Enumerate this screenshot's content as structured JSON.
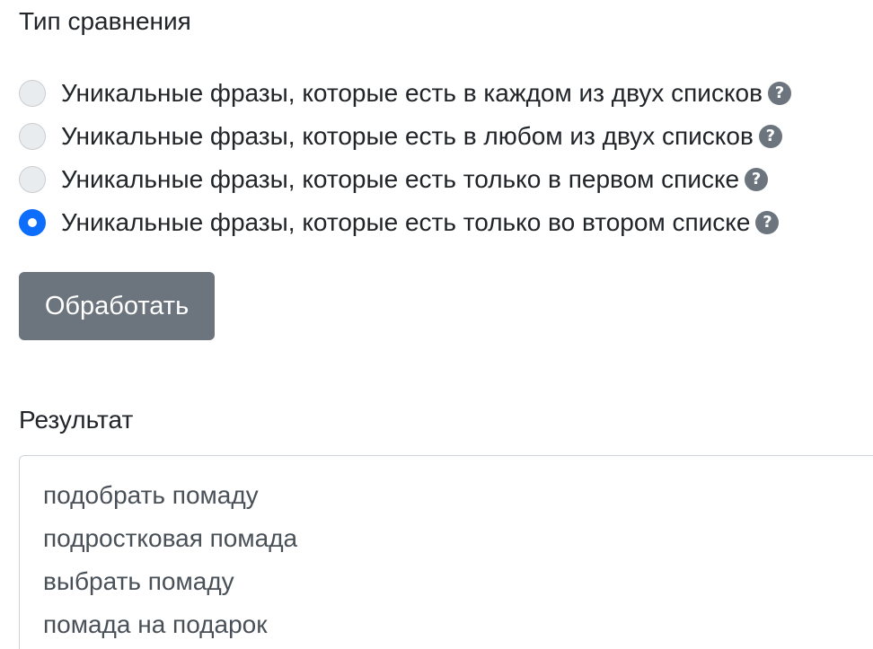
{
  "comparison": {
    "title": "Тип сравнения",
    "options": [
      {
        "label": "Уникальные фразы, которые есть в каждом из двух списков",
        "checked": false,
        "help_icon": "question-circle-icon"
      },
      {
        "label": "Уникальные фразы, которые есть в любом из двух списков",
        "checked": false,
        "help_icon": "question-circle-icon"
      },
      {
        "label": "Уникальные фразы, которые есть только в первом списке",
        "checked": false,
        "help_icon": "question-circle-icon"
      },
      {
        "label": "Уникальные фразы, которые есть только во втором списке",
        "checked": true,
        "help_icon": "question-circle-icon"
      }
    ]
  },
  "process_button": {
    "label": "Обработать"
  },
  "result": {
    "label": "Результат",
    "lines": [
      "подобрать помаду",
      "подростковая помада",
      "выбрать помаду",
      "помада на подарок"
    ]
  },
  "colors": {
    "accent": "#0d6efd",
    "button_bg": "#6c757d",
    "text": "#212529",
    "muted_text": "#495057"
  }
}
